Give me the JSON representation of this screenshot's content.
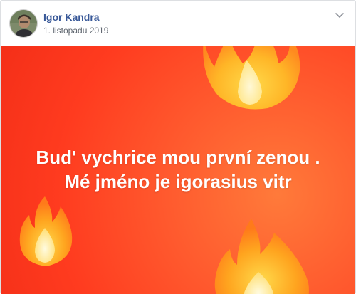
{
  "post": {
    "author_name": "Igor Kandra",
    "date": "1. listopadu 2019",
    "options_icon": "chevron-down-icon",
    "avatar_icon": "profile-photo",
    "media": {
      "line1": "Bud' vychrice mou první zenou .",
      "line2": "Mé jméno je igorasius vitr",
      "background_colors": [
        "#ff7a3a",
        "#ff3b1f"
      ],
      "decorations": [
        "fire-emoji-top-right",
        "fire-emoji-left",
        "fire-emoji-bottom-right"
      ]
    }
  }
}
